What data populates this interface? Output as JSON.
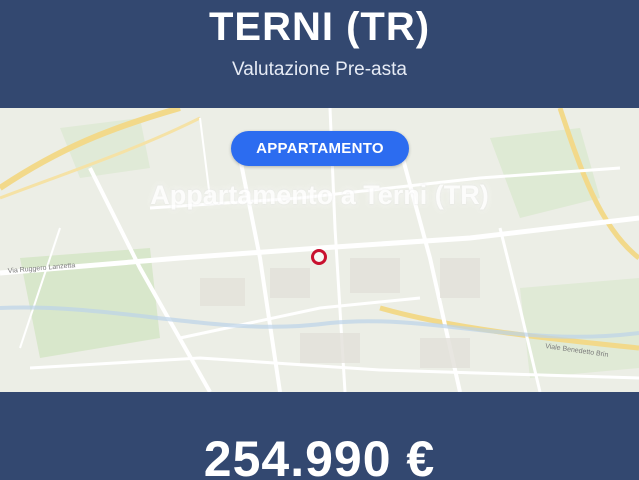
{
  "header": {
    "title": "TERNI (TR)",
    "subtitle": "Valutazione Pre-asta"
  },
  "listing": {
    "category_badge": "APPARTAMENTO",
    "map_title": "Appartamento a Terni (TR)",
    "price": "254.990 €"
  },
  "map": {
    "street_labels": [
      "Via Ruggero Lanzetta",
      "Viale Benedetto Brin"
    ],
    "marker_icon": "location-marker-icon"
  },
  "colors": {
    "header_bg": "#334870",
    "badge_bg": "#2c6cf0",
    "marker": "#c8102e",
    "map_bg": "#eceee6"
  }
}
